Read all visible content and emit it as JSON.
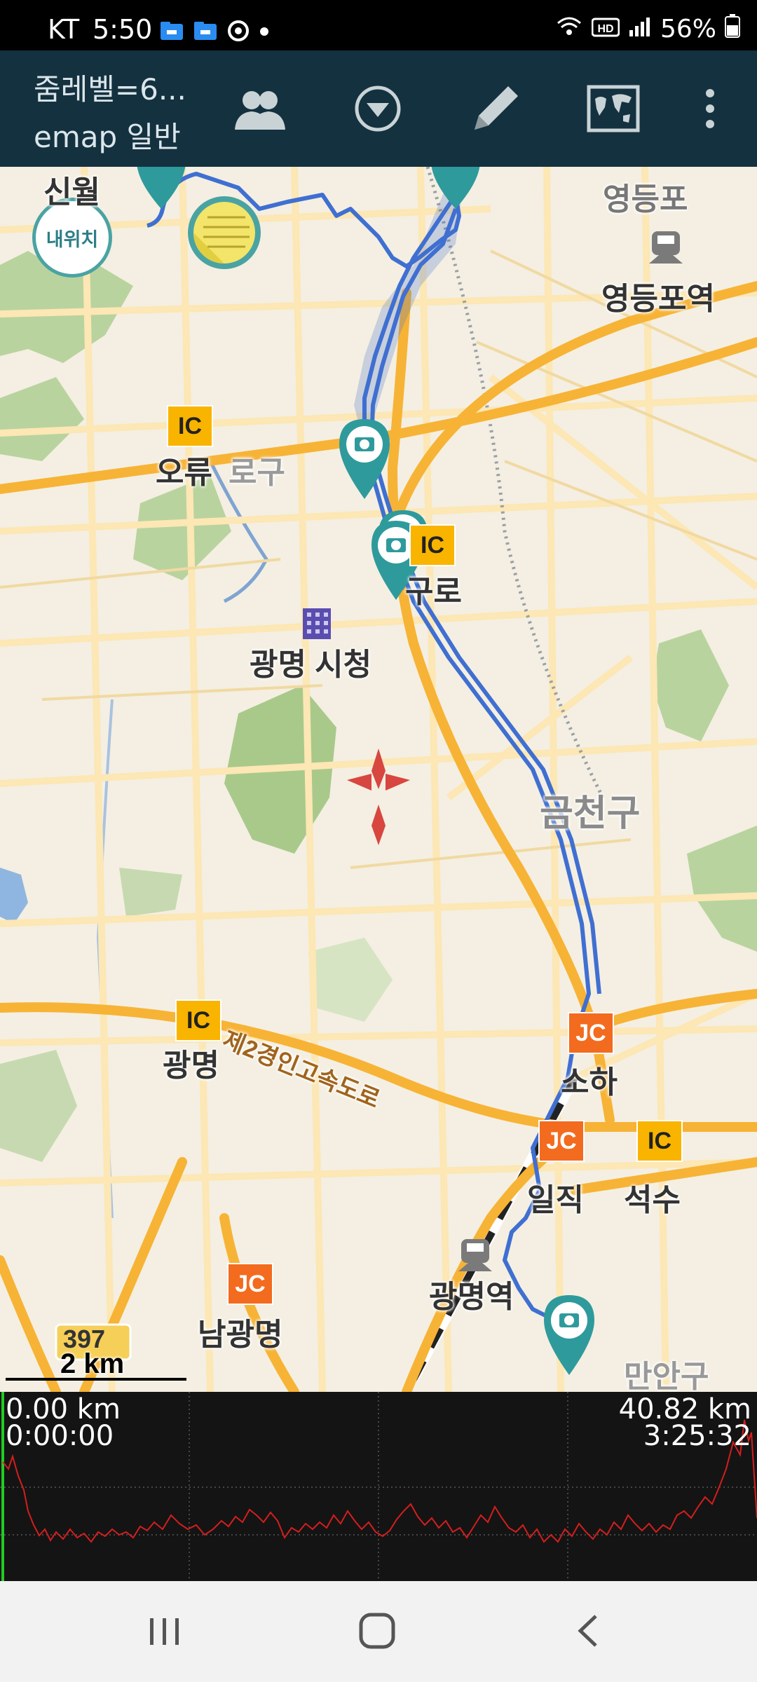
{
  "status_bar": {
    "carrier": "KT",
    "time": "5:50",
    "battery": "56%"
  },
  "app_bar": {
    "title_line1": "줌레벨=6...",
    "title_line2": "emap 일반",
    "buttons": [
      "group-icon",
      "dropdown-icon",
      "pencil-icon",
      "world-map-icon",
      "more-icon"
    ]
  },
  "map": {
    "my_location_label": "내위치",
    "labels": {
      "sinwol": "신월",
      "yeongdeungpo_station": "영등포역",
      "yeongdeungpo_gu": "영등포",
      "oryu": "오류",
      "guro_gu": "로구",
      "guro": "구로",
      "gwangmyeong_cityhall": "광명 시청",
      "geumcheon_gu": "금천구",
      "gwangmyeong": "광명",
      "expressway": "제2경인고속도로",
      "soha": "소하",
      "iljik": "일직",
      "seoksu": "석수",
      "gwangmyeong_station": "광명역",
      "namgwangmyeong": "남광명",
      "anyang": "만안구",
      "route_number": "397"
    },
    "badges": {
      "ic": "IC",
      "jc": "JC"
    },
    "scale_label": "2 km",
    "colors": {
      "track": "#3f6fd1",
      "pin": "#2f9a9c",
      "road": "#f7b335",
      "road_minor": "#fce7b5",
      "park": "#a8c88b"
    }
  },
  "elevation": {
    "start_distance": "0.00 km",
    "start_time": "0:00:00",
    "end_distance": "40.82 km",
    "end_time": "3:25:32",
    "line_color": "#d41e1e",
    "cursor_color": "#22cc22"
  },
  "nav_bar": {
    "buttons": [
      "recent-apps-icon",
      "home-icon",
      "back-icon"
    ]
  }
}
